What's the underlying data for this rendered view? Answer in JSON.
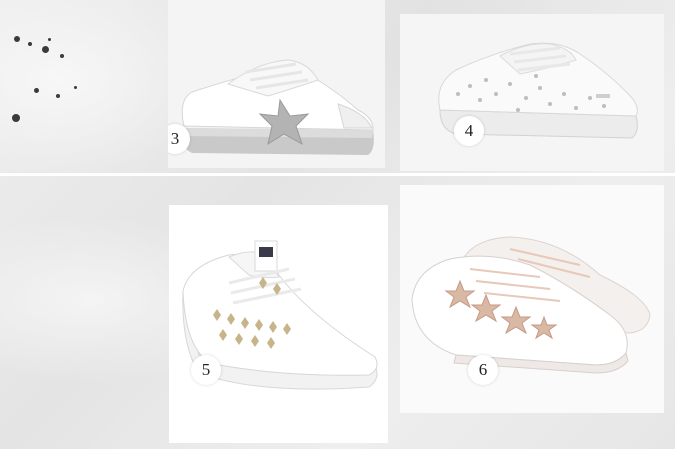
{
  "items": [
    {
      "number": "3",
      "image": "sneaker-white-glitter-star"
    },
    {
      "number": "4",
      "image": "sneaker-white-studded-stars"
    },
    {
      "number": "5",
      "image": "sneaker-white-rockstud"
    },
    {
      "number": "6",
      "image": "sneaker-white-rose-gold-stars"
    }
  ]
}
